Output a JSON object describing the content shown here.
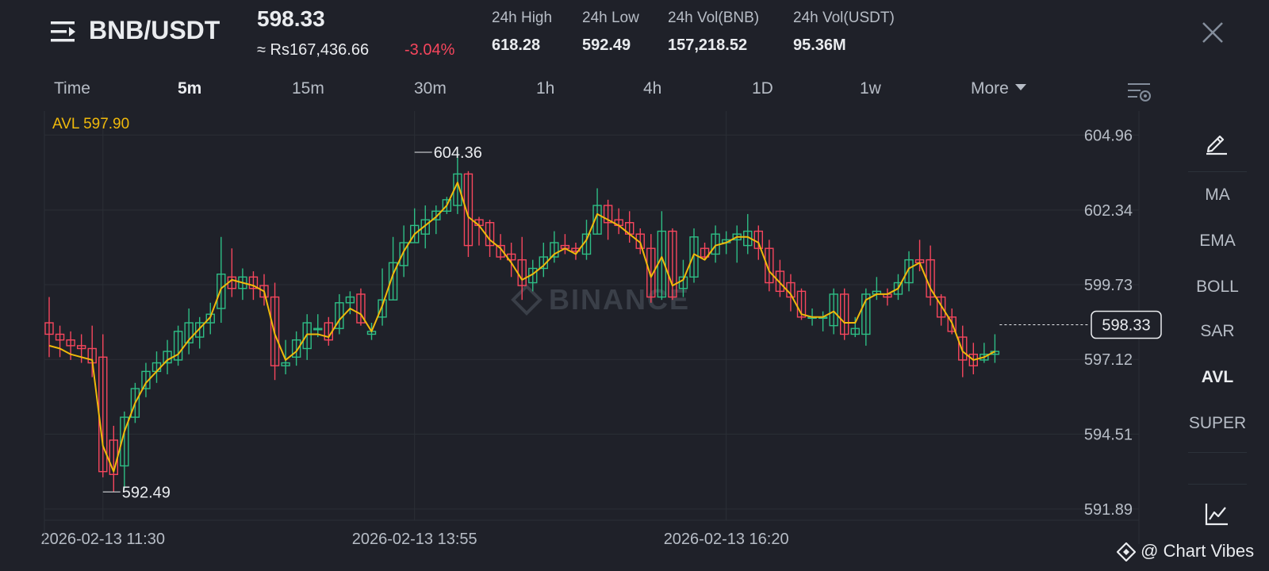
{
  "header": {
    "pair": "BNB/USDT",
    "last_price": "598.33",
    "fiat_price": "≈ Rs167,436.66",
    "change": "-3.04%",
    "stats": [
      {
        "label": "24h High",
        "value": "618.28"
      },
      {
        "label": "24h Low",
        "value": "592.49"
      },
      {
        "label": "24h Vol(BNB)",
        "value": "157,218.52"
      },
      {
        "label": "24h Vol(USDT)",
        "value": "95.36M"
      }
    ]
  },
  "tabs": [
    "Time",
    "5m",
    "15m",
    "30m",
    "1h",
    "4h",
    "1D",
    "1w",
    "More"
  ],
  "active_tab": "5m",
  "indicators": [
    "MA",
    "EMA",
    "BOLL",
    "SAR",
    "AVL",
    "SUPER"
  ],
  "active_indicator": "AVL",
  "avl_label": "AVL 597.90",
  "watermark": "BINANCE",
  "branding": "@ Chart Vibes",
  "colors": {
    "up": "#2ebd85",
    "down": "#f6465d",
    "avl": "#f0b90b",
    "grid": "#2b2f36",
    "axis_text": "#b7bdc6",
    "background": "#1f2129"
  },
  "icons": [
    "menu-lines-icon",
    "close-icon",
    "chart-settings-icon",
    "pencil-icon",
    "line-chart-icon",
    "binance-logo-icon"
  ],
  "chart_data": {
    "type": "candlestick",
    "y_ticks": [
      604.96,
      602.34,
      599.73,
      597.12,
      594.51,
      591.89
    ],
    "ylim": [
      591.5,
      605.8
    ],
    "x_ticks": [
      "2026-02-13 11:30",
      "2026-02-13 13:55",
      "2026-02-13 16:20"
    ],
    "x_tick_index": [
      5,
      34,
      63
    ],
    "last_price": 598.33,
    "high_label": "604.36",
    "high_index": 34,
    "low_label": "592.49",
    "low_index": 5,
    "candles": [
      [
        598.4,
        598.0,
        599.3,
        597.2
      ],
      [
        598.0,
        597.8,
        598.3,
        597.2
      ],
      [
        597.8,
        597.6,
        598.1,
        597.1
      ],
      [
        597.6,
        597.5,
        598.0,
        597.0
      ],
      [
        597.5,
        597.0,
        598.3,
        596.5
      ],
      [
        597.2,
        593.2,
        598.0,
        593.0
      ],
      [
        594.3,
        593.1,
        594.8,
        592.5
      ],
      [
        593.4,
        595.1,
        595.3,
        592.6
      ],
      [
        595.1,
        596.1,
        596.3,
        594.9
      ],
      [
        596.1,
        596.7,
        597.0,
        595.8
      ],
      [
        596.7,
        597.0,
        597.4,
        596.3
      ],
      [
        597.0,
        597.4,
        597.8,
        596.6
      ],
      [
        597.1,
        598.1,
        598.3,
        596.9
      ],
      [
        597.7,
        598.4,
        598.9,
        597.3
      ],
      [
        597.9,
        598.4,
        598.6,
        597.5
      ],
      [
        598.4,
        598.7,
        599.1,
        598.0
      ],
      [
        598.9,
        600.1,
        601.4,
        598.4
      ],
      [
        600.0,
        599.6,
        601.0,
        599.3
      ],
      [
        599.6,
        600.0,
        600.3,
        599.2
      ],
      [
        600.0,
        599.6,
        600.2,
        599.2
      ],
      [
        599.7,
        599.3,
        600.1,
        599.0
      ],
      [
        599.3,
        596.9,
        599.8,
        596.4
      ],
      [
        596.9,
        597.0,
        597.8,
        596.6
      ],
      [
        597.2,
        597.8,
        598.1,
        596.9
      ],
      [
        597.5,
        598.4,
        598.7,
        597.1
      ],
      [
        598.2,
        598.2,
        598.7,
        597.9
      ],
      [
        598.4,
        597.8,
        598.6,
        597.6
      ],
      [
        598.2,
        599.1,
        599.4,
        598.0
      ],
      [
        599.1,
        599.3,
        599.5,
        598.7
      ],
      [
        599.4,
        598.4,
        599.6,
        598.3
      ],
      [
        598.0,
        598.1,
        598.4,
        597.8
      ],
      [
        598.6,
        599.2,
        600.3,
        598.3
      ],
      [
        599.2,
        600.5,
        601.4,
        599.2
      ],
      [
        600.4,
        601.2,
        601.8,
        600.0
      ],
      [
        601.2,
        601.8,
        602.4,
        601.2
      ],
      [
        601.5,
        602.0,
        602.5,
        601.0
      ],
      [
        602.0,
        602.3,
        602.5,
        601.5
      ],
      [
        602.3,
        602.7,
        602.8,
        602.2
      ],
      [
        602.5,
        603.6,
        604.4,
        602.2
      ],
      [
        603.6,
        601.1,
        603.7,
        600.7
      ],
      [
        602.0,
        601.8,
        602.1,
        601.1
      ],
      [
        601.9,
        601.1,
        602.0,
        600.7
      ],
      [
        601.1,
        600.7,
        601.5,
        600.6
      ],
      [
        600.8,
        600.6,
        601.2,
        600.0
      ],
      [
        600.6,
        599.7,
        601.4,
        599.2
      ],
      [
        599.8,
        600.3,
        600.6,
        599.5
      ],
      [
        600.3,
        600.7,
        601.2,
        600.0
      ],
      [
        600.7,
        601.2,
        601.6,
        600.5
      ],
      [
        601.1,
        601.0,
        601.5,
        600.8
      ],
      [
        601.0,
        600.9,
        601.2,
        600.6
      ],
      [
        600.8,
        601.5,
        602.0,
        600.6
      ],
      [
        601.5,
        602.5,
        603.1,
        601.5
      ],
      [
        602.5,
        601.9,
        602.7,
        601.3
      ],
      [
        602.0,
        601.8,
        602.4,
        601.5
      ],
      [
        601.9,
        601.5,
        602.3,
        601.2
      ],
      [
        601.5,
        601.0,
        601.7,
        600.8
      ],
      [
        601.0,
        599.3,
        601.5,
        599.1
      ],
      [
        599.3,
        601.6,
        602.3,
        599.2
      ],
      [
        601.6,
        599.3,
        601.7,
        599.2
      ],
      [
        599.6,
        600.0,
        600.6,
        599.3
      ],
      [
        600.0,
        601.4,
        601.7,
        599.8
      ],
      [
        601.0,
        600.7,
        601.2,
        600.6
      ],
      [
        600.8,
        601.5,
        601.8,
        600.5
      ],
      [
        601.2,
        601.3,
        601.6,
        600.8
      ],
      [
        601.3,
        601.5,
        601.8,
        600.5
      ],
      [
        601.1,
        601.6,
        602.2,
        600.8
      ],
      [
        601.6,
        601.0,
        601.8,
        600.6
      ],
      [
        601.0,
        599.8,
        601.3,
        599.5
      ],
      [
        600.2,
        599.5,
        600.6,
        599.3
      ],
      [
        599.8,
        599.3,
        600.1,
        598.8
      ],
      [
        599.5,
        598.6,
        599.6,
        598.5
      ],
      [
        598.6,
        598.6,
        598.9,
        598.3
      ],
      [
        598.6,
        598.6,
        598.8,
        598.1
      ],
      [
        598.3,
        599.4,
        599.6,
        598.0
      ],
      [
        599.4,
        598.0,
        599.6,
        597.8
      ],
      [
        598.0,
        598.2,
        598.6,
        597.9
      ],
      [
        598.0,
        599.4,
        599.6,
        597.6
      ],
      [
        599.4,
        599.5,
        600.0,
        599.2
      ],
      [
        599.4,
        599.3,
        599.6,
        599.0
      ],
      [
        599.4,
        599.8,
        600.1,
        599.2
      ],
      [
        599.8,
        600.6,
        600.9,
        599.5
      ],
      [
        600.6,
        600.5,
        601.3,
        600.2
      ],
      [
        600.6,
        599.3,
        601.1,
        599.0
      ],
      [
        599.3,
        598.6,
        599.4,
        598.3
      ],
      [
        598.6,
        598.1,
        598.9,
        598.0
      ],
      [
        597.9,
        597.1,
        598.3,
        596.5
      ],
      [
        597.3,
        596.9,
        597.7,
        596.6
      ],
      [
        597.1,
        597.3,
        597.7,
        597.0
      ],
      [
        597.3,
        597.4,
        598.0,
        597.0
      ]
    ],
    "avl_values": [
      597.6,
      597.5,
      597.3,
      597.2,
      597.1,
      594.1,
      593.2,
      594.6,
      595.6,
      596.3,
      596.7,
      597.1,
      597.3,
      597.8,
      598.2,
      598.6,
      599.6,
      599.9,
      599.8,
      599.7,
      599.5,
      598.0,
      597.1,
      597.4,
      598.0,
      598.0,
      597.9,
      598.5,
      598.9,
      598.7,
      598.1,
      599.0,
      600.1,
      600.9,
      601.5,
      601.8,
      602.1,
      602.5,
      603.3,
      602.1,
      601.8,
      601.3,
      601.0,
      600.5,
      599.9,
      600.1,
      600.4,
      600.8,
      601.0,
      600.8,
      601.3,
      602.2,
      602.0,
      601.8,
      601.5,
      601.2,
      600.0,
      600.7,
      599.7,
      599.9,
      600.8,
      600.6,
      601.1,
      601.2,
      601.4,
      601.4,
      601.2,
      600.2,
      599.8,
      599.4,
      598.7,
      598.6,
      598.6,
      598.8,
      598.4,
      598.4,
      599.2,
      599.4,
      599.4,
      599.6,
      600.3,
      600.5,
      599.6,
      599.0,
      598.4,
      597.4,
      597.1,
      597.2,
      597.4
    ]
  }
}
